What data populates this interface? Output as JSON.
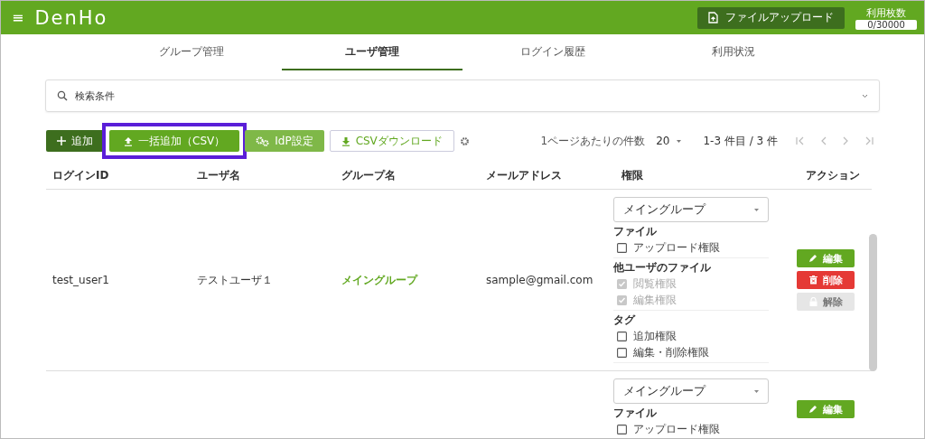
{
  "header": {
    "logo": "DenHo",
    "menu_icon": "≡",
    "upload_button": "ファイルアップロード",
    "usage_label": "利用枚数",
    "usage_value": "0/30000"
  },
  "tabs": [
    {
      "label": "グループ管理",
      "selected": false
    },
    {
      "label": "ユーザ管理",
      "selected": true
    },
    {
      "label": "ログイン履歴",
      "selected": false
    },
    {
      "label": "利用状況",
      "selected": false
    }
  ],
  "search": {
    "label": "検索条件"
  },
  "toolbar": {
    "buttons": [
      {
        "label": "追加",
        "kind": "add",
        "highlighted": false
      },
      {
        "label": "一括追加（CSV）",
        "kind": "bulk",
        "highlighted": true
      },
      {
        "label": "IdP設定",
        "kind": "idp",
        "highlighted": false
      },
      {
        "label": "CSVダウンロード",
        "kind": "download",
        "highlighted": false
      }
    ]
  },
  "pagination": {
    "per_page_label": "1ページあたりの件数",
    "per_page": "20",
    "range": "1-3 件目 / 3 件"
  },
  "table": {
    "columns": [
      "ログインID",
      "ユーザ名",
      "グループ名",
      "メールアドレス",
      "権限",
      "アクション"
    ],
    "rows": [
      {
        "login_id": "test_user1",
        "user_name": "テストユーザ１",
        "group": "メイングループ",
        "email": "sample@gmail.com",
        "permission_group": "メイングループ",
        "sections": [
          {
            "title": "ファイル",
            "items": [
              {
                "label": "アップロード権限",
                "checked": false,
                "disabled": false
              }
            ]
          },
          {
            "title": "他ユーザのファイル",
            "items": [
              {
                "label": "閲覧権限",
                "checked": true,
                "disabled": true
              },
              {
                "label": "編集権限",
                "checked": true,
                "disabled": true
              }
            ]
          },
          {
            "title": "タグ",
            "items": [
              {
                "label": "追加権限",
                "checked": false,
                "disabled": false
              },
              {
                "label": "編集・削除権限",
                "checked": false,
                "disabled": false
              }
            ]
          }
        ],
        "actions": [
          {
            "label": "編集",
            "kind": "edit",
            "disabled": false
          },
          {
            "label": "削除",
            "kind": "delete",
            "disabled": false
          },
          {
            "label": "解除",
            "kind": "unlock",
            "disabled": true
          }
        ]
      },
      {
        "login_id": "",
        "user_name": "",
        "group": "",
        "email": "",
        "permission_group": "メイングループ",
        "sections": [
          {
            "title": "ファイル",
            "items": [
              {
                "label": "アップロード権限",
                "checked": false,
                "disabled": false
              }
            ]
          }
        ],
        "actions": [
          {
            "label": "編集",
            "kind": "edit",
            "disabled": false
          }
        ]
      }
    ]
  }
}
